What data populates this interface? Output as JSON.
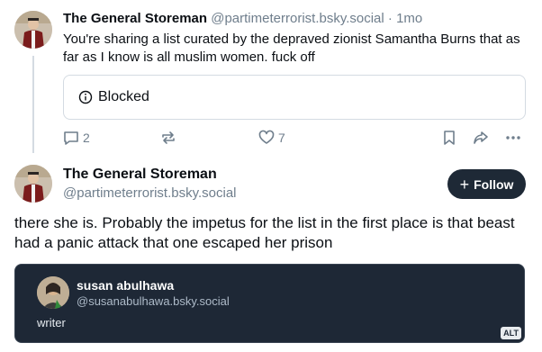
{
  "reply": {
    "author_name": "The General Storeman",
    "author_handle": "@partimeterrorist.bsky.social",
    "separator": " · ",
    "time": "1mo",
    "text": "You're sharing a list curated by the depraved zionist Samantha Burns that as far as I know is all muslim women. fuck off",
    "blocked_label": "Blocked",
    "reply_count": "2",
    "like_count": "7"
  },
  "post": {
    "author_name": "The General Storeman",
    "author_handle": "@partimeterrorist.bsky.social",
    "follow_label": "Follow",
    "text": "there she is. Probably the impetus for the list in the first place is that beast had a panic attack that one escaped her prison"
  },
  "embed": {
    "name": "susan abulhawa",
    "handle": "@susanabulhawa.bsky.social",
    "bio": "writer",
    "alt_badge": "ALT"
  },
  "icons": {
    "blocked": "info-circle-icon",
    "reply": "speech-bubble-icon",
    "repost": "repost-icon",
    "like": "heart-icon",
    "bookmark": "bookmark-icon",
    "share": "share-icon",
    "more": "more-dots-icon",
    "follow": "plus-icon"
  },
  "colors": {
    "muted": "#6f7e8c",
    "follow_button": "#1e2936",
    "embed_bg": "#1e2836",
    "thread_line": "#d4dbe2"
  }
}
